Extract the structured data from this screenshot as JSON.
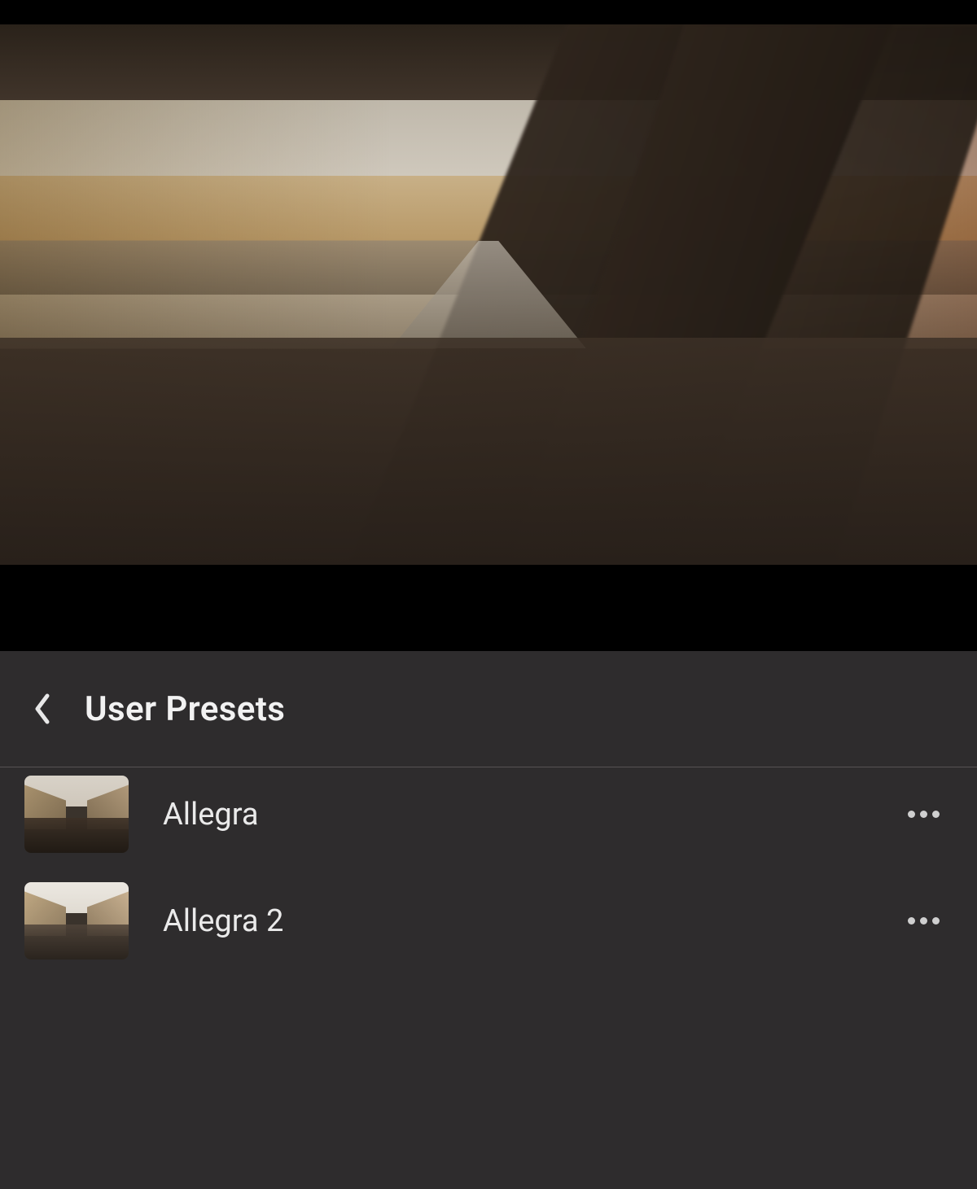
{
  "panel": {
    "title": "User Presets"
  },
  "presets": [
    {
      "label": "Allegra"
    },
    {
      "label": "Allegra 2"
    }
  ]
}
